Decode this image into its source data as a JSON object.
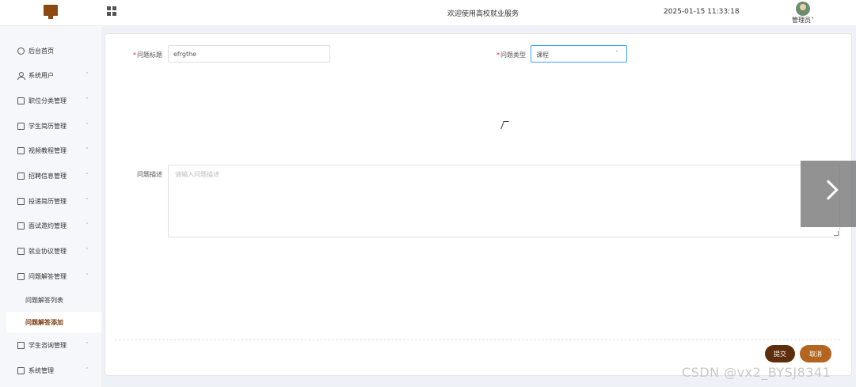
{
  "header": {
    "welcome": "欢迎使用高校就业服务",
    "datetime": "2025-01-15 11:33:18",
    "user": "管理员˅"
  },
  "sidebar": {
    "items": [
      {
        "label": "后台首页",
        "icon": "clock-icon",
        "has_arrow": false
      },
      {
        "label": "系统用户",
        "icon": "user-icon",
        "has_arrow": true
      },
      {
        "label": "职位分类管理",
        "icon": "menu-icon",
        "has_arrow": true
      },
      {
        "label": "学生简历管理",
        "icon": "menu-icon",
        "has_arrow": true
      },
      {
        "label": "视频教程管理",
        "icon": "menu-icon",
        "has_arrow": true
      },
      {
        "label": "招聘信息管理",
        "icon": "menu-icon",
        "has_arrow": true
      },
      {
        "label": "投递简历管理",
        "icon": "menu-icon",
        "has_arrow": true
      },
      {
        "label": "面试邀约管理",
        "icon": "menu-icon",
        "has_arrow": true
      },
      {
        "label": "就业协议管理",
        "icon": "menu-icon",
        "has_arrow": true
      },
      {
        "label": "问题解答管理",
        "icon": "menu-icon",
        "has_arrow": true,
        "expanded": true
      },
      {
        "label": "学生咨询管理",
        "icon": "menu-icon",
        "has_arrow": true
      },
      {
        "label": "系统管理",
        "icon": "folder-icon",
        "has_arrow": true
      }
    ],
    "sub_items": [
      {
        "label": "问题解答列表",
        "active": false
      },
      {
        "label": "问题解答添加",
        "active": true
      }
    ],
    "chevron_down": "˅",
    "chevron_up": "˄"
  },
  "form": {
    "title_label": "问题标题",
    "title_value": "efrgthe",
    "type_label": "问题类型",
    "type_value": "课程",
    "desc_label": "问题描述",
    "desc_placeholder": "请输入问题描述",
    "required_mark": "*",
    "submit_label": "提交",
    "cancel_label": "取消"
  },
  "watermark": "CSDN @vx2_BYSJ8341",
  "colors": {
    "brand": "#8b4a12",
    "submit": "#5e2e0c",
    "cancel": "#b3651f",
    "active_menu": "#7a3c10",
    "focus_border": "#409eff"
  }
}
